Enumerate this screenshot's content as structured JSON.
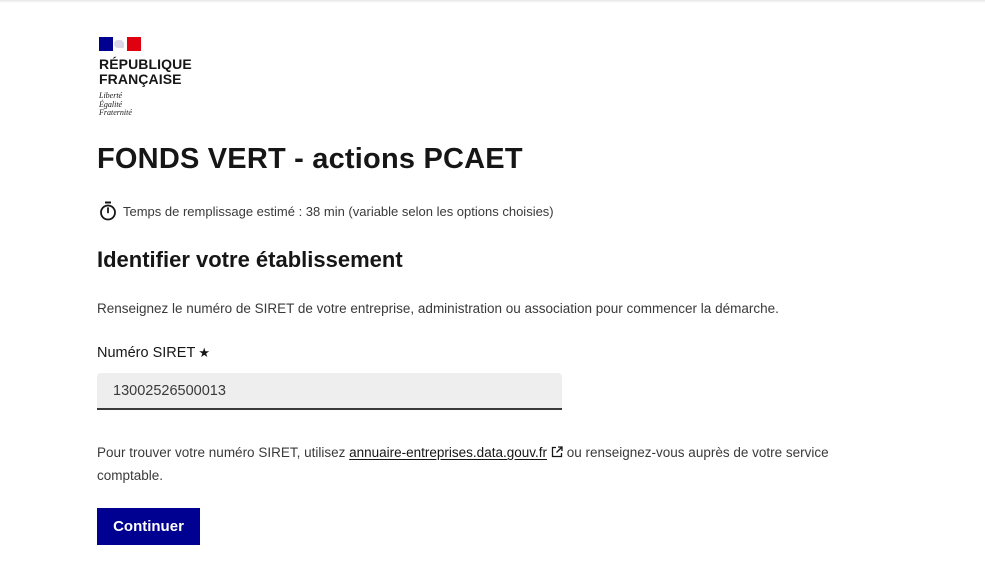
{
  "logo": {
    "line1": "RÉPUBLIQUE",
    "line2": "FRANÇAISE",
    "motto1": "Liberté",
    "motto2": "Égalité",
    "motto3": "Fraternité",
    "flag_colors": [
      "#000091",
      "#ffffff",
      "#e1000f"
    ]
  },
  "page": {
    "title": "FONDS VERT - actions PCAET",
    "estimate_icon": "timer-icon",
    "estimate_text": "Temps de remplissage estimé : 38 min (variable selon les options choisies)"
  },
  "section": {
    "title": "Identifier votre établissement",
    "intro": "Renseignez le numéro de SIRET de votre entreprise, administration ou association pour commencer la démarche."
  },
  "siret_field": {
    "label": "Numéro SIRET",
    "required_mark": "★",
    "value": "13002526500013"
  },
  "help": {
    "prefix": "Pour trouver votre numéro SIRET, utilisez ",
    "link_text": "annuaire-entreprises.data.gouv.fr",
    "link_icon": "external-link-icon",
    "suffix": " ou renseignez-vous auprès de votre service comptable."
  },
  "actions": {
    "continue_label": "Continuer"
  },
  "colors": {
    "primary": "#000091",
    "input_bg": "#eeeeee",
    "text": "#161616"
  }
}
